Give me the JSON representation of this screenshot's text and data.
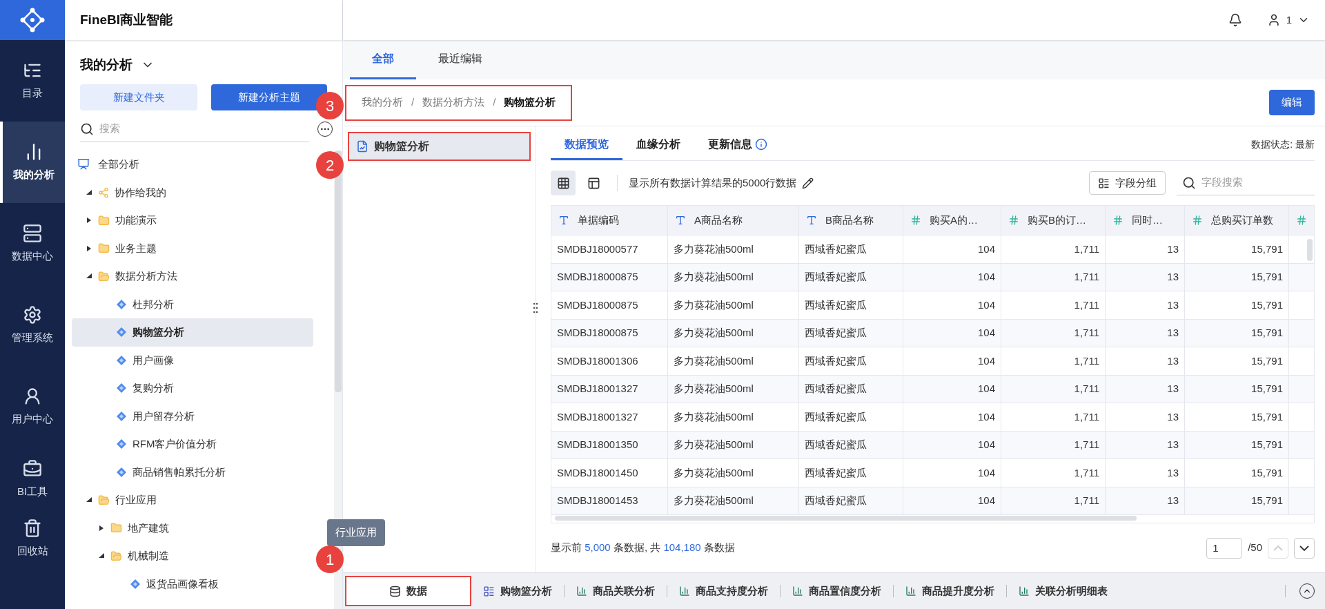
{
  "app": {
    "title": "FineBI商业智能",
    "user": "1"
  },
  "nav": [
    {
      "kind": "catalog",
      "label": "目录",
      "selected": false
    },
    {
      "kind": "analysis",
      "label": "我的分析",
      "selected": true
    },
    {
      "kind": "data",
      "label": "数据中心",
      "selected": false
    },
    {
      "kind": "admin",
      "label": "管理系统",
      "selected": false
    },
    {
      "kind": "user",
      "label": "用户中心",
      "selected": false
    },
    {
      "kind": "tools",
      "label": "BI工具",
      "selected": false
    },
    {
      "kind": "trash",
      "label": "回收站",
      "selected": false
    }
  ],
  "sidebar": {
    "title": "我的分析",
    "buttons": [
      {
        "kind": "secondary",
        "label": "新建文件夹"
      },
      {
        "kind": "primary",
        "label": "新建分析主题"
      }
    ],
    "search": {
      "placeholder": "搜索"
    },
    "tree": {
      "label": "全部分析",
      "children": [
        {
          "kind": "shared",
          "label": "协作给我的",
          "expanded": true
        },
        {
          "kind": "folder",
          "label": "功能演示",
          "expanded": false
        },
        {
          "kind": "folder",
          "label": "业务主题",
          "expanded": false
        },
        {
          "kind": "folder",
          "label": "数据分析方法",
          "expanded": true,
          "children": [
            {
              "kind": "item",
              "label": "杜邦分析",
              "selected": false
            },
            {
              "kind": "item",
              "label": "购物篮分析",
              "selected": true
            },
            {
              "kind": "item",
              "label": "用户画像",
              "selected": false
            },
            {
              "kind": "item",
              "label": "复购分析",
              "selected": false
            },
            {
              "kind": "item",
              "label": "用户留存分析",
              "selected": false
            },
            {
              "kind": "item",
              "label": "RFM客户价值分析",
              "selected": false
            },
            {
              "kind": "item",
              "label": "商品销售帕累托分析",
              "selected": false
            }
          ]
        },
        {
          "kind": "folder",
          "label": "行业应用",
          "expanded": true,
          "children": [
            {
              "kind": "folder",
              "label": "地产建筑",
              "expanded": false
            },
            {
              "kind": "folder",
              "label": "机械制造",
              "expanded": true,
              "children": [
                {
                  "kind": "item",
                  "label": "返货品画像看板",
                  "selected": false
                }
              ]
            }
          ]
        }
      ]
    }
  },
  "tooltip": "行业应用",
  "top_tabs": [
    {
      "label": "全部",
      "selected": true
    },
    {
      "label": "最近编辑",
      "selected": false
    }
  ],
  "breadcrumb": {
    "highlighted": true,
    "separator": "/",
    "items": [
      "我的分析",
      "数据分析方法",
      "购物篮分析"
    ]
  },
  "edit_button": "编辑",
  "datasets": [
    {
      "label": "购物篮分析",
      "selected": true,
      "highlighted": true
    }
  ],
  "detail_tabs": [
    {
      "label": "数据预览",
      "selected": true,
      "info": false
    },
    {
      "label": "血缘分析",
      "selected": false,
      "info": false
    },
    {
      "label": "更新信息",
      "selected": false,
      "info": true
    }
  ],
  "data_status": "数据状态: 最新",
  "toolbar": {
    "views": [
      {
        "kind": "grid",
        "selected": true
      },
      {
        "kind": "layout",
        "selected": false
      }
    ],
    "caption": "显示所有数据计算结果的5000行数据",
    "group_button": "字段分组",
    "field_search": {
      "placeholder": "字段搜索"
    }
  },
  "table": {
    "columns": [
      {
        "kind": "text",
        "label": "单据编码"
      },
      {
        "kind": "text",
        "label": "A商品名称"
      },
      {
        "kind": "text",
        "label": "B商品名称"
      },
      {
        "kind": "number",
        "label": "购买A的…"
      },
      {
        "kind": "number",
        "label": "购买B的订…"
      },
      {
        "kind": "number",
        "label": "同时…"
      },
      {
        "kind": "number",
        "label": "总购买订单数"
      },
      {
        "kind": "number"
      }
    ],
    "rows": [
      [
        "SMDBJ18000577",
        "多力葵花油500ml",
        "西域香妃蜜瓜",
        "104",
        "1,711",
        "13",
        "15,791"
      ],
      [
        "SMDBJ18000875",
        "多力葵花油500ml",
        "西域香妃蜜瓜",
        "104",
        "1,711",
        "13",
        "15,791"
      ],
      [
        "SMDBJ18000875",
        "多力葵花油500ml",
        "西域香妃蜜瓜",
        "104",
        "1,711",
        "13",
        "15,791"
      ],
      [
        "SMDBJ18000875",
        "多力葵花油500ml",
        "西域香妃蜜瓜",
        "104",
        "1,711",
        "13",
        "15,791"
      ],
      [
        "SMDBJ18001306",
        "多力葵花油500ml",
        "西域香妃蜜瓜",
        "104",
        "1,711",
        "13",
        "15,791"
      ],
      [
        "SMDBJ18001327",
        "多力葵花油500ml",
        "西域香妃蜜瓜",
        "104",
        "1,711",
        "13",
        "15,791"
      ],
      [
        "SMDBJ18001327",
        "多力葵花油500ml",
        "西域香妃蜜瓜",
        "104",
        "1,711",
        "13",
        "15,791"
      ],
      [
        "SMDBJ18001350",
        "多力葵花油500ml",
        "西域香妃蜜瓜",
        "104",
        "1,711",
        "13",
        "15,791"
      ],
      [
        "SMDBJ18001450",
        "多力葵花油500ml",
        "西域香妃蜜瓜",
        "104",
        "1,711",
        "13",
        "15,791"
      ],
      [
        "SMDBJ18001453",
        "多力葵花油500ml",
        "西域香妃蜜瓜",
        "104",
        "1,711",
        "13",
        "15,791"
      ]
    ]
  },
  "summary": {
    "prefix": "显示前",
    "shown": "5,000",
    "middle": "条数据, 共",
    "total": "104,180",
    "suffix": "条数据"
  },
  "pagination": {
    "page": "1",
    "total": "/50"
  },
  "bottom_tabs": [
    {
      "kind": "data",
      "label": "数据",
      "selected": true,
      "highlighted": true
    },
    {
      "kind": "analysis",
      "label": "购物篮分析",
      "selected": false,
      "highlighted": false
    },
    {
      "kind": "dashboard",
      "label": "商品关联分析",
      "selected": false,
      "highlighted": false
    },
    {
      "kind": "dashboard",
      "label": "商品支持度分析",
      "selected": false,
      "highlighted": false
    },
    {
      "kind": "dashboard",
      "label": "商品置信度分析",
      "selected": false,
      "highlighted": false
    },
    {
      "kind": "dashboard",
      "label": "商品提升度分析",
      "selected": false,
      "highlighted": false
    },
    {
      "kind": "dashboard",
      "label": "关联分析明细表",
      "selected": false,
      "highlighted": false
    }
  ],
  "annotations": [
    {
      "kind": "breadcrumb",
      "label": "3"
    },
    {
      "kind": "dataset",
      "label": "2"
    },
    {
      "kind": "bottom",
      "label": "1"
    }
  ]
}
